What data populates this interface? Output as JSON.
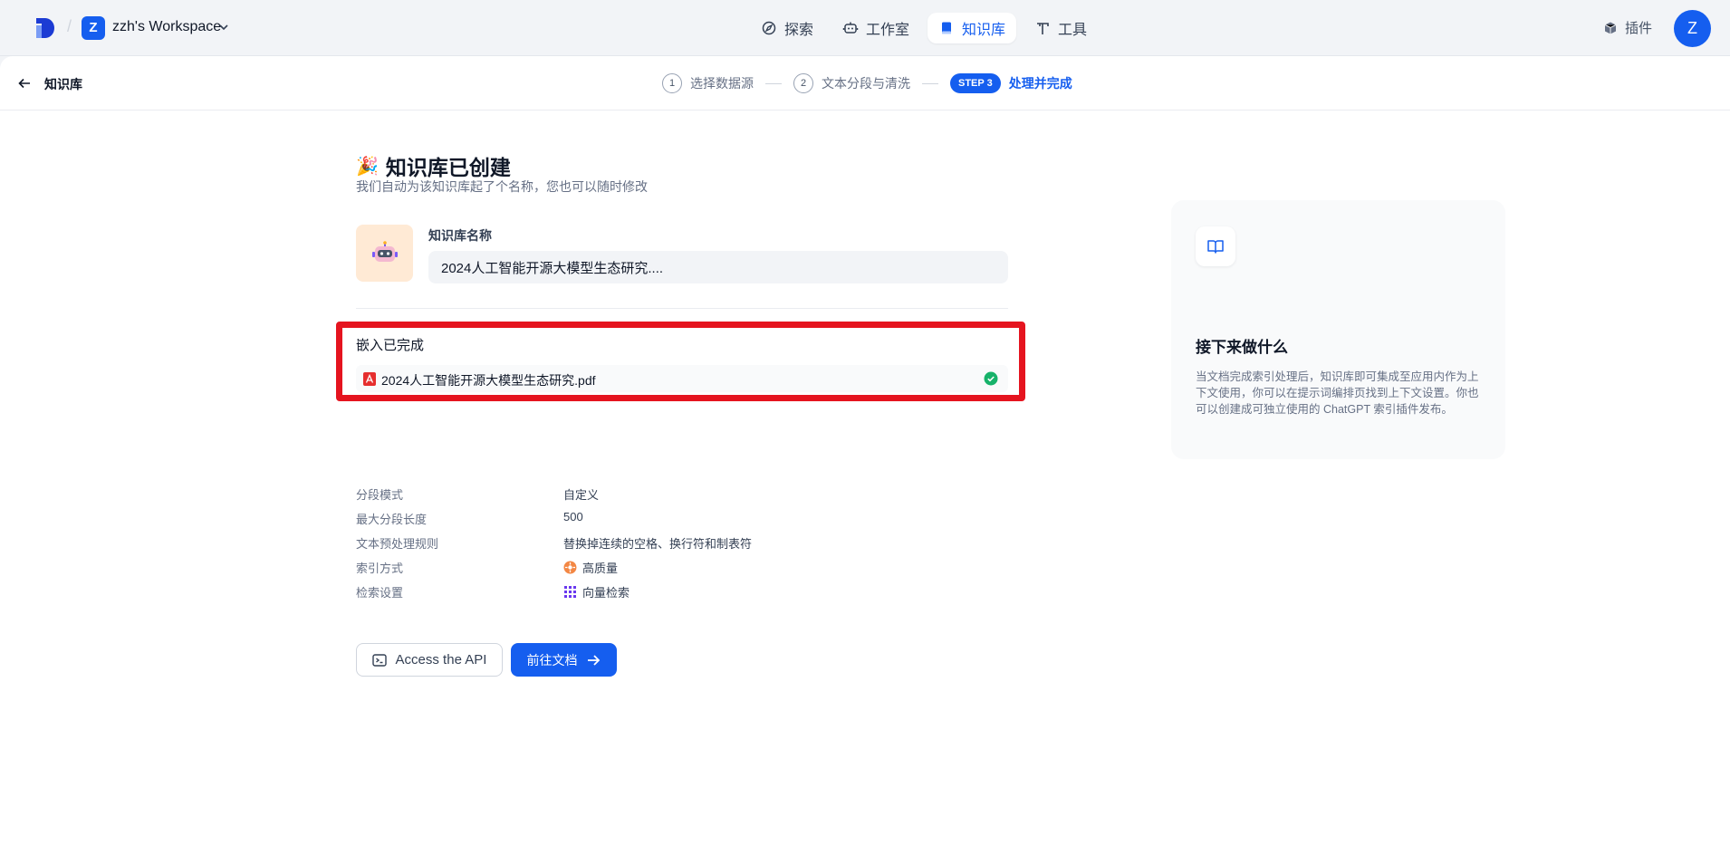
{
  "workspace": {
    "avatar_letter": "Z",
    "name": "zzh's Workspace"
  },
  "nav": [
    {
      "label": "探索",
      "icon": "compass-icon",
      "active": false
    },
    {
      "label": "工作室",
      "icon": "robot-icon",
      "active": false
    },
    {
      "label": "知识库",
      "icon": "book-icon",
      "active": true
    },
    {
      "label": "工具",
      "icon": "hammer-icon",
      "active": false
    }
  ],
  "plugin_label": "插件",
  "user_avatar_letter": "Z",
  "subheader": {
    "back_label": "知识库",
    "steps": [
      {
        "num": "1",
        "label": "选择数据源"
      },
      {
        "num": "2",
        "label": "文本分段与清洗"
      },
      {
        "num": "STEP 3",
        "label": "处理并完成"
      }
    ]
  },
  "content": {
    "title": "知识库已创建",
    "subtitle": "我们自动为该知识库起了个名称，您也可以随时修改",
    "name_label": "知识库名称",
    "name_value": "2024人工智能开源大模型生态研究....",
    "embed_title": "嵌入已完成",
    "file_name": "2024人工智能开源大模型生态研究.pdf",
    "props": [
      {
        "key": "分段模式",
        "value": "自定义",
        "icon": ""
      },
      {
        "key": "最大分段长度",
        "value": "500",
        "icon": ""
      },
      {
        "key": "文本预处理规则",
        "value": "替换掉连续的空格、换行符和制表符",
        "icon": ""
      },
      {
        "key": "索引方式",
        "value": "高质量",
        "icon": "high-quality-icon"
      },
      {
        "key": "检索设置",
        "value": "向量检索",
        "icon": "vector-search-icon"
      }
    ],
    "api_button": "Access the API",
    "docs_button": "前往文档"
  },
  "side": {
    "title": "接下来做什么",
    "text": "当文档完成索引处理后，知识库即可集成至应用内作为上下文使用，你可以在提示词编排页找到上下文设置。你也可以创建成可独立使用的 ChatGPT 索引插件发布。"
  },
  "colors": {
    "accent": "#155eef",
    "highlight": "#e5141f"
  }
}
